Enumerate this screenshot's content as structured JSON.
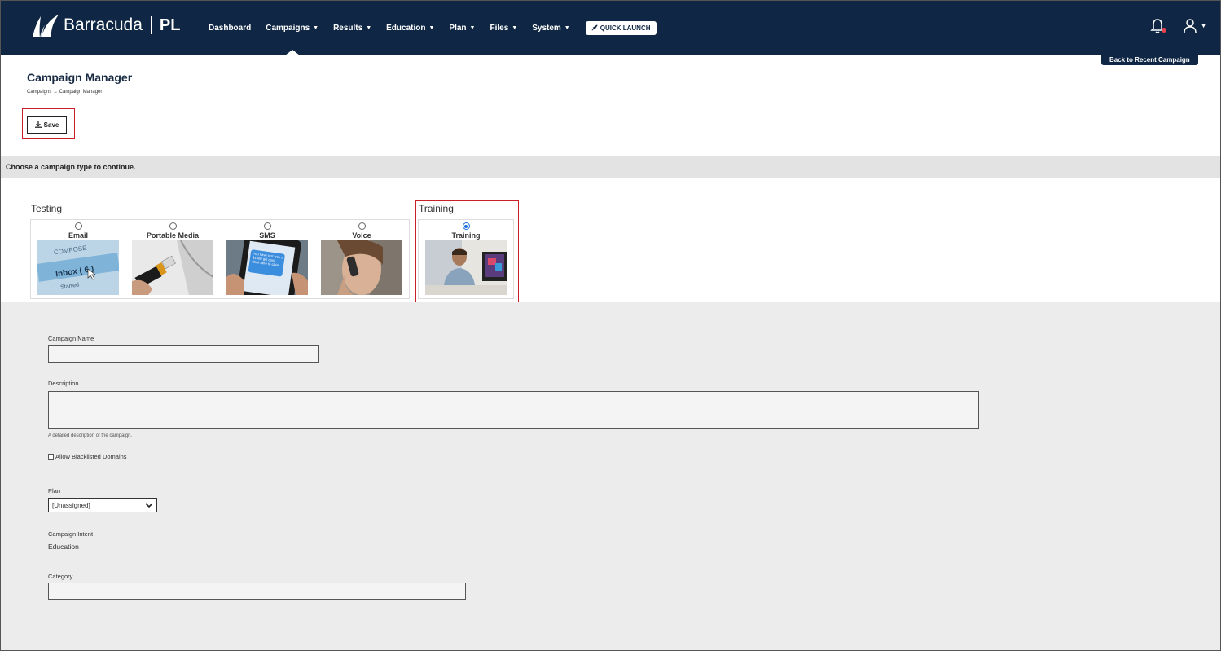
{
  "brand": {
    "name": "Barracuda",
    "product": "PL"
  },
  "nav": {
    "items": [
      {
        "label": "Dashboard",
        "has_caret": false,
        "active": false
      },
      {
        "label": "Campaigns",
        "has_caret": true,
        "active": true
      },
      {
        "label": "Results",
        "has_caret": true,
        "active": false
      },
      {
        "label": "Education",
        "has_caret": true,
        "active": false
      },
      {
        "label": "Plan",
        "has_caret": true,
        "active": false
      },
      {
        "label": "Files",
        "has_caret": true,
        "active": false
      },
      {
        "label": "System",
        "has_caret": true,
        "active": false
      }
    ],
    "quick_launch": "QUICK LAUNCH",
    "colors": {
      "bg": "#0f2744",
      "notification_dot": "#e8424f"
    }
  },
  "header": {
    "back_button": "Back to Recent Campaign",
    "title": "Campaign Manager",
    "breadcrumb": "Campaigns → Campaign Manager",
    "save_label": "Save"
  },
  "instruction": "Choose a campaign type to continue.",
  "campaign_types": {
    "testing_label": "Testing",
    "training_label": "Training",
    "testing": [
      {
        "label": "Email",
        "selected": false,
        "image": "email-inbox-compose"
      },
      {
        "label": "Portable Media",
        "selected": false,
        "image": "usb-drive-laptop"
      },
      {
        "label": "SMS",
        "selected": false,
        "image": "phone-sms-message"
      },
      {
        "label": "Voice",
        "selected": false,
        "image": "woman-on-phone"
      }
    ],
    "training": [
      {
        "label": "Training",
        "selected": true,
        "image": "man-at-computer"
      }
    ],
    "email_image_text": {
      "compose": "COMPOSE",
      "inbox": "Inbox ( 6 )",
      "starred": "Starred"
    },
    "sms_image_text": "You have just won a $1000 gift card. Click here to claim your gift"
  },
  "form": {
    "campaign_name": {
      "label": "Campaign Name",
      "value": ""
    },
    "description": {
      "label": "Description",
      "value": "",
      "hint": "A detailed description of the campaign."
    },
    "allow_blacklisted": {
      "label": "Allow Blacklisted Domains",
      "checked": false
    },
    "plan": {
      "label": "Plan",
      "selected": "[Unassigned]"
    },
    "campaign_intent": {
      "label": "Campaign Intent",
      "value": "Education"
    },
    "category": {
      "label": "Category",
      "value": ""
    }
  },
  "highlight_color": "#c91f28"
}
